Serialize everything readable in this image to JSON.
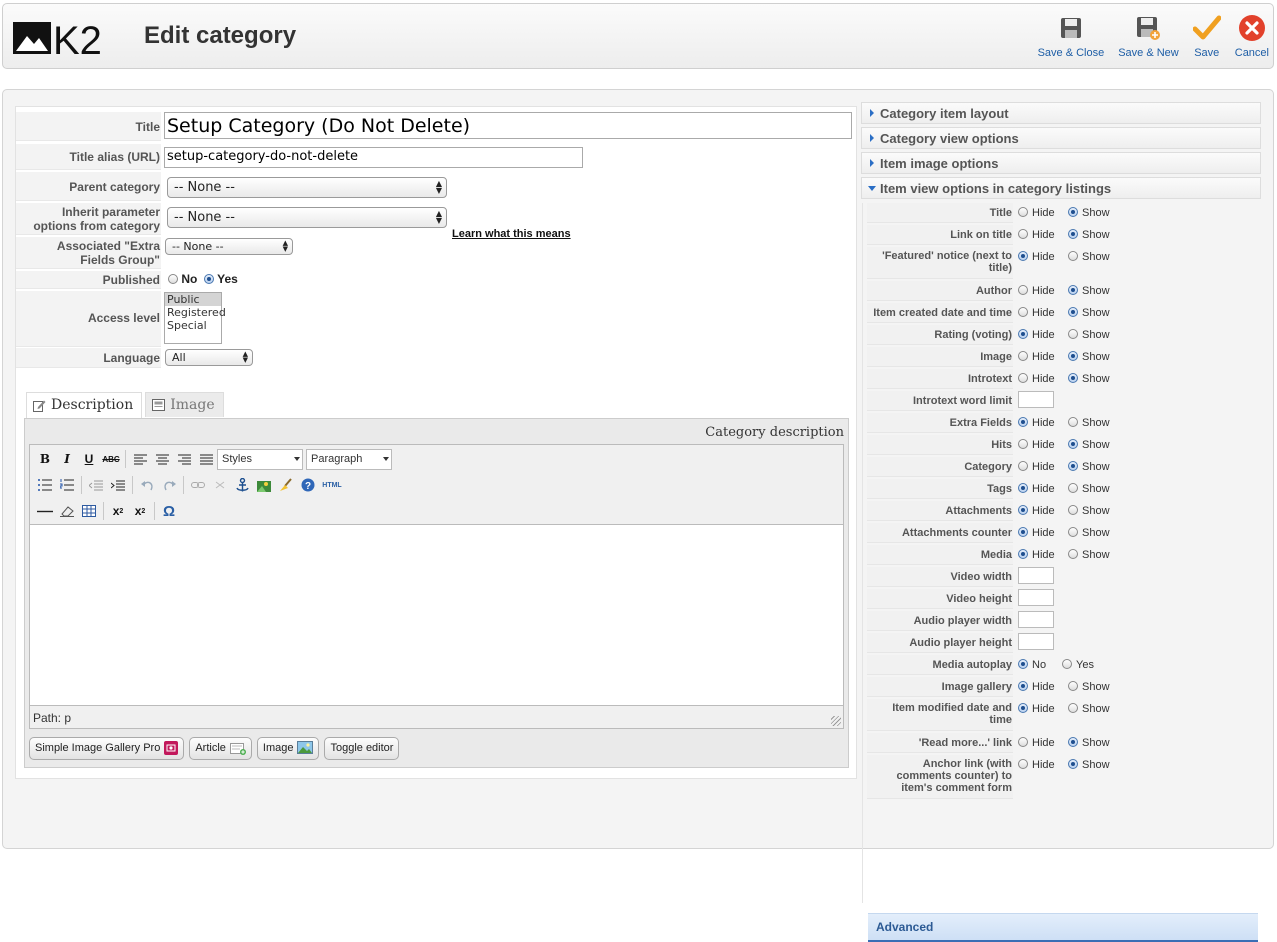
{
  "header": {
    "logo_text": "K2",
    "title": "Edit category",
    "toolbar": [
      {
        "label": "Save & Close",
        "icon": "save-close-icon"
      },
      {
        "label": "Save & New",
        "icon": "save-new-icon"
      },
      {
        "label": "Save",
        "icon": "check-icon"
      },
      {
        "label": "Cancel",
        "icon": "cancel-icon"
      }
    ]
  },
  "form": {
    "title_label": "Title",
    "title_value": "Setup Category (Do Not Delete)",
    "alias_label": "Title alias (URL)",
    "alias_value": "setup-category-do-not-delete",
    "parent_label": "Parent category",
    "parent_value": "-- None --",
    "inherit_label_1": "Inherit parameter",
    "inherit_label_2": "options from category",
    "inherit_value": "-- None --",
    "learn_link": "Learn what this means",
    "extra_label_1": "Associated \"Extra",
    "extra_label_2": "Fields Group\"",
    "extra_value": "-- None --",
    "published_label": "Published",
    "published_no": "No",
    "published_yes": "Yes",
    "access_label": "Access level",
    "access_options": [
      "Public",
      "Registered",
      "Special"
    ],
    "language_label": "Language",
    "language_value": "All"
  },
  "editor": {
    "tabs": [
      "Description",
      "Image"
    ],
    "caption": "Category description",
    "styles_select": "Styles",
    "format_select": "Paragraph",
    "path": "Path: p",
    "html_label": "HTML",
    "buttons": [
      "Simple Image Gallery Pro",
      "Article",
      "Image",
      "Toggle editor"
    ]
  },
  "right": {
    "sections": [
      "Category item layout",
      "Category view options",
      "Item image options",
      "Item view options in category listings"
    ],
    "hide": "Hide",
    "show": "Show",
    "no": "No",
    "yes": "Yes",
    "options": [
      {
        "label": "Title",
        "type": "hs",
        "value": "Show"
      },
      {
        "label": "Link on title",
        "type": "hs",
        "value": "Show"
      },
      {
        "label": "'Featured' notice (next to title)",
        "type": "hs",
        "value": "Hide"
      },
      {
        "label": "Author",
        "type": "hs",
        "value": "Show"
      },
      {
        "label": "Item created date and time",
        "type": "hs",
        "value": "Show"
      },
      {
        "label": "Rating (voting)",
        "type": "hs",
        "value": "Hide"
      },
      {
        "label": "Image",
        "type": "hs",
        "value": "Show"
      },
      {
        "label": "Introtext",
        "type": "hs",
        "value": "Show"
      },
      {
        "label": "Introtext word limit",
        "type": "input",
        "value": ""
      },
      {
        "label": "Extra Fields",
        "type": "hs",
        "value": "Hide"
      },
      {
        "label": "Hits",
        "type": "hs",
        "value": "Show"
      },
      {
        "label": "Category",
        "type": "hs",
        "value": "Show"
      },
      {
        "label": "Tags",
        "type": "hs",
        "value": "Hide"
      },
      {
        "label": "Attachments",
        "type": "hs",
        "value": "Hide"
      },
      {
        "label": "Attachments counter",
        "type": "hs",
        "value": "Hide"
      },
      {
        "label": "Media",
        "type": "hs",
        "value": "Hide"
      },
      {
        "label": "Video width",
        "type": "input",
        "value": ""
      },
      {
        "label": "Video height",
        "type": "input",
        "value": ""
      },
      {
        "label": "Audio player width",
        "type": "input",
        "value": ""
      },
      {
        "label": "Audio player height",
        "type": "input",
        "value": ""
      },
      {
        "label": "Media autoplay",
        "type": "ny",
        "value": "No"
      },
      {
        "label": "Image gallery",
        "type": "hs",
        "value": "Hide"
      },
      {
        "label": "Item modified date and time",
        "type": "hs",
        "value": "Hide"
      },
      {
        "label": "'Read more...' link",
        "type": "hs",
        "value": "Show"
      },
      {
        "label": "Anchor link (with comments counter) to item's comment form",
        "type": "hs",
        "value": "Show"
      }
    ],
    "advanced": "Advanced"
  }
}
